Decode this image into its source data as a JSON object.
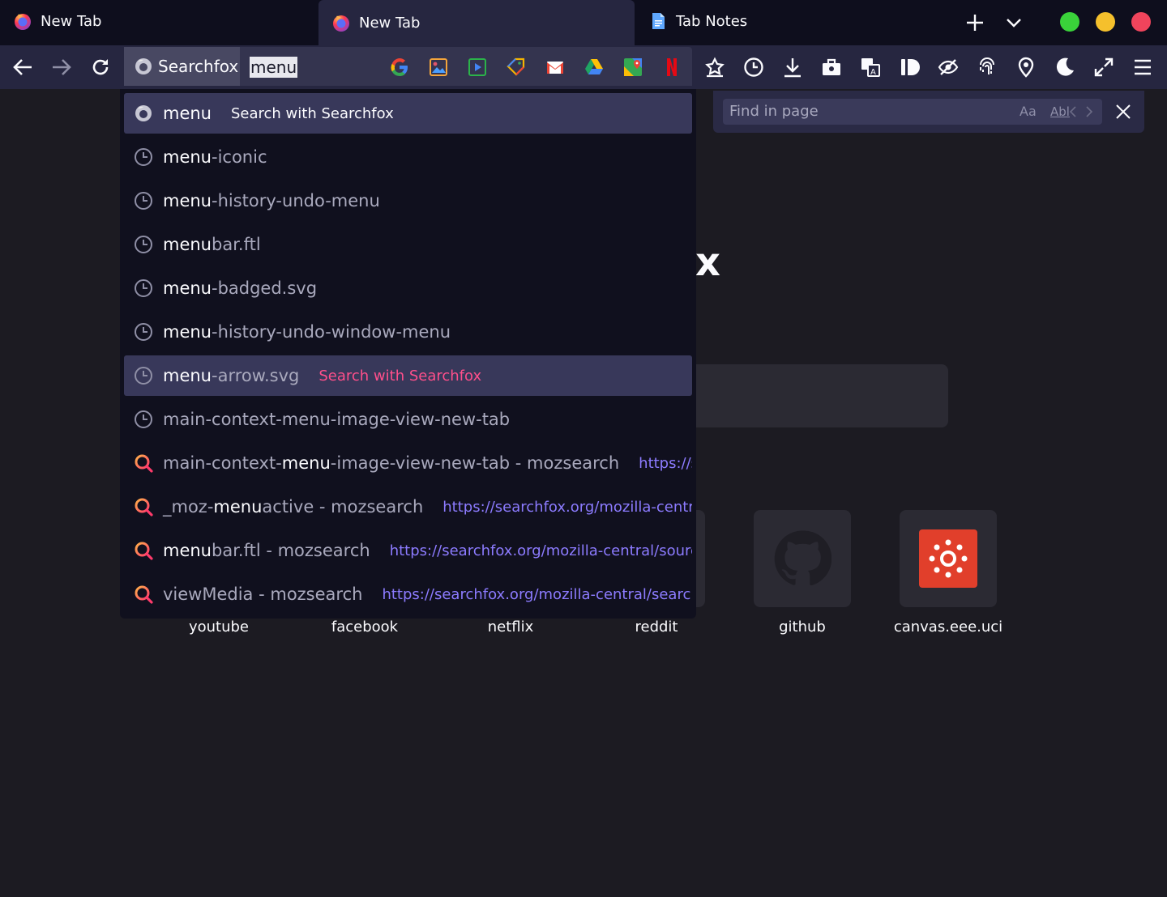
{
  "tabs": [
    {
      "title": "New Tab",
      "icon": "firefox-icon"
    },
    {
      "title": "New Tab",
      "icon": "firefox-icon",
      "active": true
    },
    {
      "title": "Tab Notes",
      "icon": "document-icon"
    }
  ],
  "window_controls": {
    "green": "#3ad23a",
    "yellow": "#f5c02c",
    "red": "#f0445c"
  },
  "urlbar": {
    "engine": "Searchfox",
    "typed": "menu",
    "oneoff_engines": [
      "google-icon",
      "images-icon",
      "play-store-icon",
      "tag-icon",
      "gmail-icon",
      "drive-icon",
      "maps-icon",
      "netflix-icon"
    ]
  },
  "toolbar_icons": [
    "bookmark-star-icon",
    "history-icon",
    "download-icon",
    "toolbox-icon",
    "translate-icon",
    "id-icon",
    "hide-eye-icon",
    "fingerprint-icon",
    "location-pin-icon",
    "dark-mode-moon-icon",
    "fullscreen-icon",
    "menu-icon"
  ],
  "findbar": {
    "placeholder": "Find in page",
    "match_case": "Aa",
    "whole_word": "Abl"
  },
  "page": {
    "brand_fragment": "x",
    "top_sites": [
      {
        "label": "youtube"
      },
      {
        "label": "facebook"
      },
      {
        "label": "netflix"
      },
      {
        "label": "reddit"
      },
      {
        "label": "github"
      },
      {
        "label": "canvas.eee.uci"
      }
    ]
  },
  "suggestions": [
    {
      "type": "search",
      "pre": "",
      "match": "menu",
      "post": "",
      "action": "Search with Searchfox",
      "selected": true
    },
    {
      "type": "history",
      "pre": "",
      "match": "menu",
      "post": "-iconic"
    },
    {
      "type": "history",
      "pre": "",
      "match": "menu",
      "post": "-history-undo-menu"
    },
    {
      "type": "history",
      "pre": "",
      "match": "menu",
      "post": "bar.ftl"
    },
    {
      "type": "history",
      "pre": "",
      "match": "menu",
      "post": "-badged.svg"
    },
    {
      "type": "history",
      "pre": "",
      "match": "menu",
      "post": "-history-undo-window-menu"
    },
    {
      "type": "history",
      "pre": "",
      "match": "menu",
      "post": "-arrow.svg",
      "action": "Search with Searchfox",
      "hover": true
    },
    {
      "type": "history",
      "pre": "main-context-menu-image-view-new-tab",
      "match": "",
      "post": ""
    },
    {
      "type": "searchfox",
      "pre": "main-context-",
      "match": "menu",
      "post": "-image-view-new-tab - mozsearch",
      "url": "https://searchfox.org/mozilla-central/search"
    },
    {
      "type": "searchfox",
      "pre": "_moz-",
      "match": "menu",
      "post": "active - mozsearch",
      "url": "https://searchfox.org/mozilla-central/search"
    },
    {
      "type": "searchfox",
      "pre": "",
      "match": "menu",
      "post": "bar.ftl - mozsearch",
      "url": "https://searchfox.org/mozilla-central/source/browser"
    },
    {
      "type": "searchfox",
      "pre": "viewMedia - mozsearch",
      "match": "",
      "post": "",
      "url": "https://searchfox.org/mozilla-central/search?q=getElementById"
    }
  ]
}
